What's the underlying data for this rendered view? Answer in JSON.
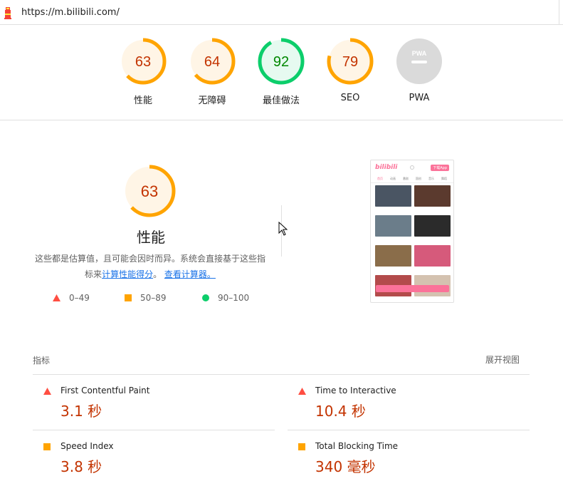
{
  "url_bar": {
    "url": "https://m.bilibili.com/"
  },
  "gauges": [
    {
      "score": "63",
      "label": "性能",
      "color": "#ffa400",
      "text_color": "#c33300",
      "fill": "#fff5e6",
      "fraction": 0.63
    },
    {
      "score": "64",
      "label": "无障碍",
      "color": "#ffa400",
      "text_color": "#c33300",
      "fill": "#fff5e6",
      "fraction": 0.64
    },
    {
      "score": "92",
      "label": "最佳做法",
      "color": "#0cce6b",
      "text_color": "#008800",
      "fill": "#e6faf0",
      "fraction": 0.92
    },
    {
      "score": "79",
      "label": "SEO",
      "color": "#ffa400",
      "text_color": "#c33300",
      "fill": "#fff5e6",
      "fraction": 0.79
    },
    {
      "score": "",
      "label": "PWA",
      "badge_text": "PWA",
      "color": "#d6d6d6",
      "text_color": "#ffffff",
      "fill": "#d9d9d9",
      "fraction": 0
    }
  ],
  "performance": {
    "score": "63",
    "fraction": 0.63,
    "title": "性能",
    "desc_text": "这些都是估算值，且可能会因时而异。系统会直接基于这些指标来",
    "link1": "计算性能得分",
    "sep": "。",
    "link2": "查看计算器。",
    "legend": [
      {
        "range": "0–49",
        "shape": "triangle",
        "color": "#ff4e42"
      },
      {
        "range": "50–89",
        "shape": "square",
        "color": "#ffa400"
      },
      {
        "range": "90–100",
        "shape": "circle",
        "color": "#0cce6b"
      }
    ]
  },
  "phone_screenshot": {
    "logo": "bilibili",
    "download_label": "下载App",
    "tabs": [
      "首页",
      "动画",
      "番剧",
      "国创",
      "音乐",
      "舞蹈"
    ],
    "thumb_colors": [
      "#4a5563",
      "#5b3a2e",
      "#6b7d8a",
      "#2b2b2b",
      "#8a6d4a",
      "#d65a7b",
      "#b34b4b",
      "#d4c2b0"
    ]
  },
  "metrics": {
    "title": "指标",
    "expand": "展开视图",
    "items": [
      {
        "name": "First Contentful Paint",
        "value": "3.1 秒",
        "shape": "triangle",
        "color": "#ff4e42"
      },
      {
        "name": "Time to Interactive",
        "value": "10.4 秒",
        "shape": "triangle",
        "color": "#ff4e42"
      },
      {
        "name": "Speed Index",
        "value": "3.8 秒",
        "shape": "square",
        "color": "#ffa400"
      },
      {
        "name": "Total Blocking Time",
        "value": "340 毫秒",
        "shape": "square",
        "color": "#ffa400"
      }
    ]
  }
}
